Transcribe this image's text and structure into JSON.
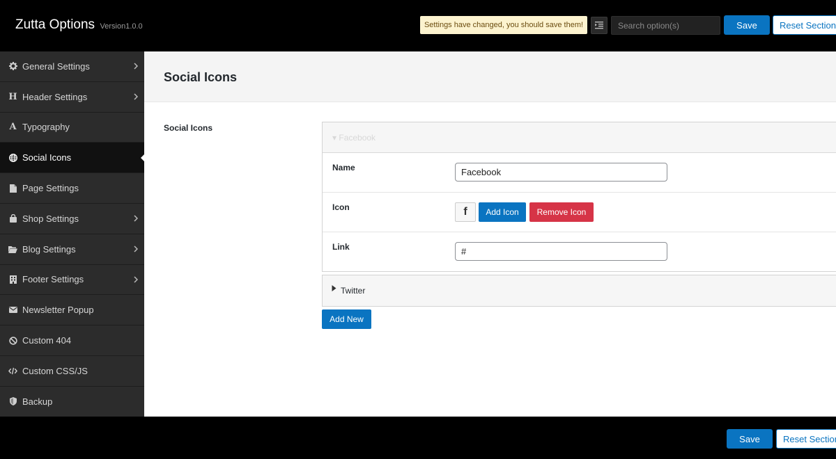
{
  "header": {
    "title": "Zutta Options",
    "version": "Version1.0.0",
    "notice": "Settings have changed, you should save them!",
    "search_placeholder": "Search option(s)",
    "save_label": "Save",
    "reset_label": "Reset Section"
  },
  "sidebar": {
    "items": [
      {
        "label": "General Settings",
        "icon": "gear-icon",
        "has_submenu": true
      },
      {
        "label": "Header Settings",
        "icon": "heading-icon",
        "has_submenu": true
      },
      {
        "label": "Typography",
        "icon": "font-icon",
        "has_submenu": false
      },
      {
        "label": "Social Icons",
        "icon": "globe-icon",
        "has_submenu": false,
        "active": true
      },
      {
        "label": "Page Settings",
        "icon": "file-icon",
        "has_submenu": false
      },
      {
        "label": "Shop Settings",
        "icon": "shopping-bag-icon",
        "has_submenu": true
      },
      {
        "label": "Blog Settings",
        "icon": "folder-open-icon",
        "has_submenu": true
      },
      {
        "label": "Footer Settings",
        "icon": "building-icon",
        "has_submenu": true
      },
      {
        "label": "Newsletter Popup",
        "icon": "envelope-icon",
        "has_submenu": false
      },
      {
        "label": "Custom 404",
        "icon": "ban-icon",
        "has_submenu": false
      },
      {
        "label": "Custom CSS/JS",
        "icon": "code-icon",
        "has_submenu": false
      },
      {
        "label": "Backup",
        "icon": "shield-icon",
        "has_submenu": false
      }
    ]
  },
  "main": {
    "title": "Social Icons",
    "field_label": "Social Icons",
    "groups": [
      {
        "title": "Facebook",
        "expanded": true,
        "fields": {
          "name_label": "Name",
          "name_value": "Facebook",
          "icon_label": "Icon",
          "icon_glyph": "f",
          "add_icon_label": "Add Icon",
          "remove_icon_label": "Remove Icon",
          "link_label": "Link",
          "link_value": "#"
        }
      },
      {
        "title": "Twitter",
        "expanded": false
      }
    ],
    "add_new_label": "Add New"
  },
  "footer": {
    "save_label": "Save",
    "reset_label": "Reset Section"
  },
  "colors": {
    "primary": "#0a74c1",
    "danger": "#d63447",
    "notice_bg": "#fcf3cf",
    "sidebar_bg": "#2c2c2c",
    "active_bg": "#111111"
  }
}
